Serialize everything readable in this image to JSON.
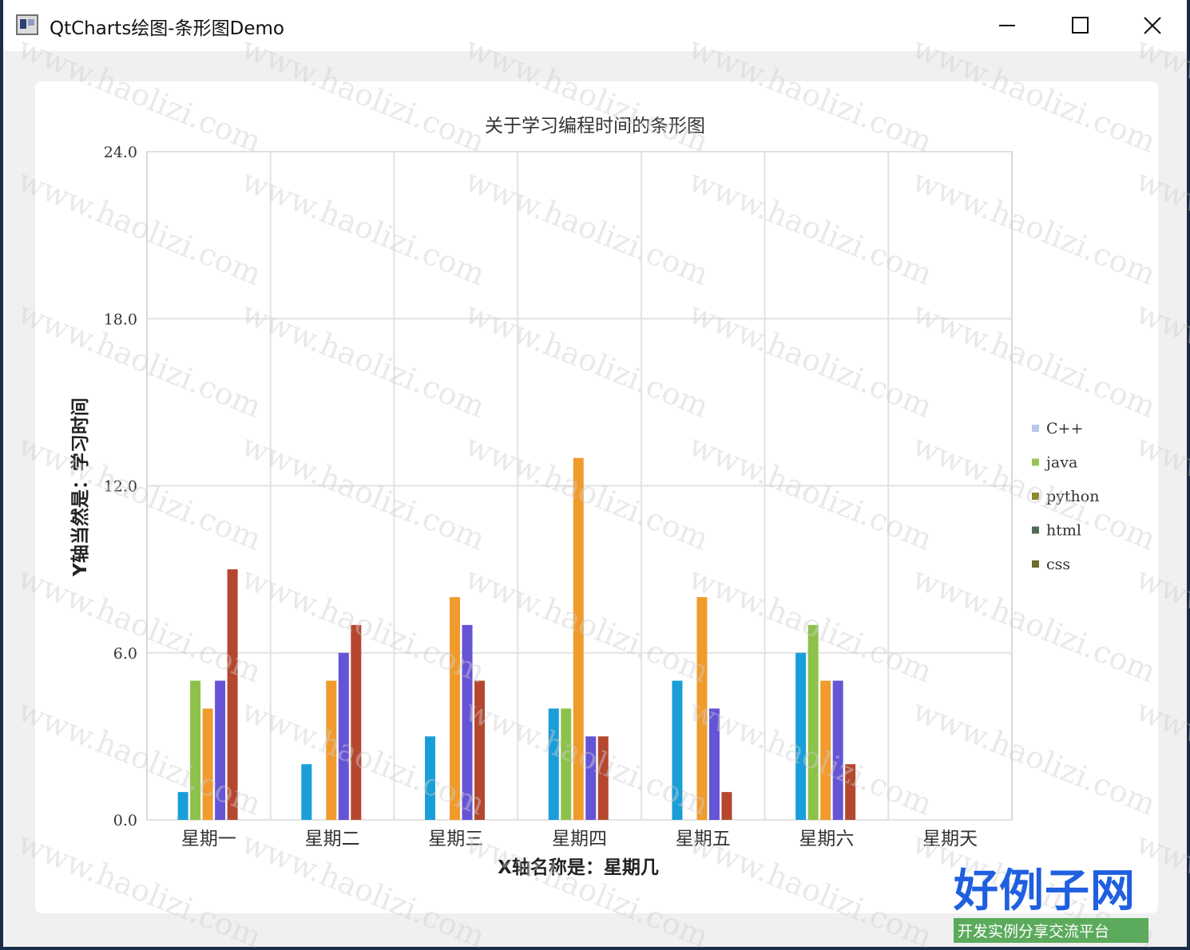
{
  "window": {
    "title": "QtCharts绘图-条形图Demo",
    "controls": {
      "minimize": "minimize",
      "maximize": "maximize",
      "close": "close"
    }
  },
  "chart_data": {
    "type": "bar",
    "title": "关于学习编程时间的条形图",
    "xlabel": "X轴名称是：星期几",
    "ylabel": "Y轴当然是：学习时间",
    "categories": [
      "星期一",
      "星期二",
      "星期三",
      "星期四",
      "星期五",
      "星期六",
      "星期天"
    ],
    "ylim": [
      0,
      24
    ],
    "yticks": [
      "0.0",
      "6.0",
      "12.0",
      "18.0",
      "24.0"
    ],
    "grid": true,
    "legend_position": "right",
    "series": [
      {
        "name": "C++",
        "color": "#1a9ed8",
        "legend_color": "#b9c8ec",
        "values": [
          1,
          2,
          3,
          4,
          5,
          6,
          0
        ]
      },
      {
        "name": "java",
        "color": "#8dc24a",
        "legend_color": "#98c45a",
        "values": [
          5,
          0,
          0,
          4,
          0,
          7,
          0
        ]
      },
      {
        "name": "python",
        "color": "#f19b2c",
        "legend_color": "#8a8a2e",
        "values": [
          4,
          5,
          8,
          13,
          8,
          5,
          0
        ]
      },
      {
        "name": "html",
        "color": "#6654d6",
        "legend_color": "#4f6a55",
        "values": [
          5,
          6,
          7,
          3,
          4,
          5,
          0
        ]
      },
      {
        "name": "css",
        "color": "#b5472f",
        "legend_color": "#6d6a2a",
        "values": [
          9,
          7,
          5,
          3,
          1,
          2,
          0
        ]
      }
    ]
  },
  "watermark": "www.haolizi.com",
  "logo": {
    "main": "好例子网",
    "sub": "开发实例分享交流平台"
  }
}
